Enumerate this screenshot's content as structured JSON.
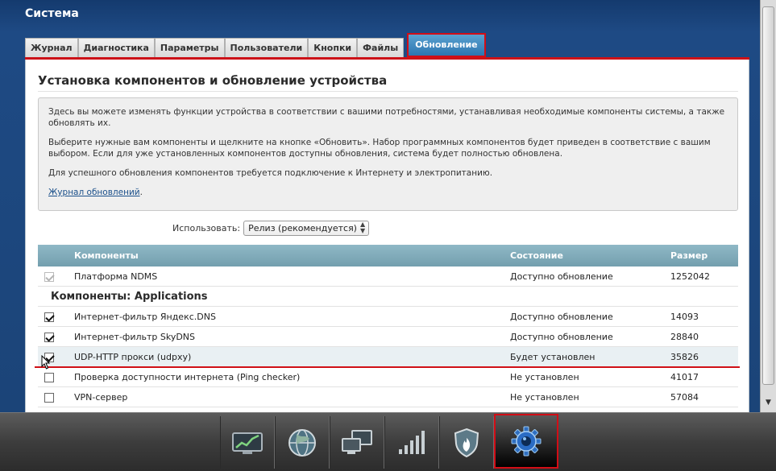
{
  "app": {
    "title": "Система"
  },
  "tabs": [
    {
      "label": "Журнал",
      "active": false
    },
    {
      "label": "Диагностика",
      "active": false
    },
    {
      "label": "Параметры",
      "active": false
    },
    {
      "label": "Пользователи",
      "active": false
    },
    {
      "label": "Кнопки",
      "active": false
    },
    {
      "label": "Файлы",
      "active": false
    },
    {
      "label": "Обновление",
      "active": true
    }
  ],
  "page": {
    "heading": "Установка компонентов и обновление устройства",
    "info": {
      "p1": "Здесь вы можете изменять функции устройства в соответствии с вашими потребностями, устанавливая необходимые компоненты системы, а также обновлять их.",
      "p2": "Выберите нужные вам компоненты и щелкните на кнопке «Обновить». Набор программных компонентов будет приведен в соответствие с вашим выбором. Если для уже установленных компонентов доступны обновления, система будет полностью обновлена.",
      "p3": "Для успешного обновления компонентов требуется подключение к Интернету и электропитанию.",
      "link": "Журнал обновлений",
      "link_suffix": "."
    },
    "use": {
      "label": "Использовать:",
      "selected": "Релиз (рекомендуется)"
    }
  },
  "table": {
    "headers": {
      "components": "Компоненты",
      "state": "Состояние",
      "size": "Размер"
    },
    "platform": {
      "name": "Платформа NDMS",
      "state": "Доступно обновление",
      "size": "1252042",
      "checked": true,
      "disabled": true
    },
    "group_title": "Компоненты: Applications",
    "rows": [
      {
        "name": "Интернет-фильтр Яндекс.DNS",
        "state": "Доступно обновление",
        "size": "14093",
        "checked": true
      },
      {
        "name": "Интернет-фильтр SkyDNS",
        "state": "Доступно обновление",
        "size": "28840",
        "checked": true
      },
      {
        "name": "UDP-HTTP прокси (udpxy)",
        "state": "Будет установлен",
        "size": "35826",
        "checked": true
      },
      {
        "name": "Проверка доступности интернета (Ping checker)",
        "state": "Не установлен",
        "size": "41017",
        "checked": false
      },
      {
        "name": "VPN-сервер",
        "state": "Не установлен",
        "size": "57084",
        "checked": false
      }
    ]
  },
  "dock": [
    {
      "icon": "chart-monitor-icon"
    },
    {
      "icon": "globe-icon"
    },
    {
      "icon": "network-computers-icon"
    },
    {
      "icon": "signal-bars-icon"
    },
    {
      "icon": "shield-flame-icon"
    },
    {
      "icon": "gear-icon",
      "active": true
    }
  ]
}
